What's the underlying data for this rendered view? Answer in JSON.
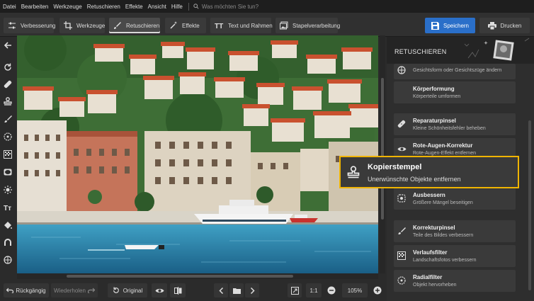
{
  "menu": {
    "items": [
      "Datei",
      "Bearbeiten",
      "Werkzeuge",
      "Retuschieren",
      "Effekte",
      "Ansicht",
      "Hilfe"
    ],
    "search_placeholder": "Was möchten Sie tun?"
  },
  "toolbar": {
    "tabs": [
      {
        "label": "Verbesserung",
        "active": false
      },
      {
        "label": "Werkzeuge",
        "active": false
      },
      {
        "label": "Retuschieren",
        "active": true
      },
      {
        "label": "Effekte",
        "active": false
      },
      {
        "label": "Text und Rahmen",
        "active": false
      }
    ],
    "batch_label": "Stapelverarbeitung",
    "save_label": "Speichern",
    "print_label": "Drucken"
  },
  "panel": {
    "title": "RETUSCHIEREN",
    "items": [
      {
        "title": "",
        "desc": "Gesichtsform oder Gesichtszüge ändern",
        "icon": "face-icon"
      },
      {
        "title": "Körperformung",
        "desc": "Körperteile umformen",
        "icon": "body-icon"
      },
      {
        "title": "Reparaturpinsel",
        "desc": "Kleine Schönheitsfehler beheben",
        "icon": "bandage-icon"
      },
      {
        "title": "Rote-Augen-Korrektur",
        "desc": "Rote-Augen-Effekt entfernen",
        "icon": "eye-icon"
      },
      {
        "title": "",
        "desc": "",
        "icon": "stamp-icon"
      },
      {
        "title": "Ausbessern",
        "desc": "Größere Mängel beseitigen",
        "icon": "patch-icon"
      },
      {
        "title": "Korrekturpinsel",
        "desc": "Teile des Bildes verbessern",
        "icon": "brush-icon"
      },
      {
        "title": "Verlaufsfilter",
        "desc": "Landschaftsfotos verbessern",
        "icon": "gradient-icon"
      },
      {
        "title": "Radialfilter",
        "desc": "Objekt hervorheben",
        "icon": "radial-icon"
      }
    ]
  },
  "tooltip": {
    "title": "Kopierstempel",
    "desc": "Unerwünschte Objekte entfernen"
  },
  "bottombar": {
    "undo_label": "Rückgängig",
    "redo_label": "Wiederholen",
    "original_label": "Original",
    "zoom_1to1": "1:1",
    "zoom_value": "105%"
  },
  "colors": {
    "accent": "#2a6fc9",
    "highlight": "#f0b400"
  }
}
